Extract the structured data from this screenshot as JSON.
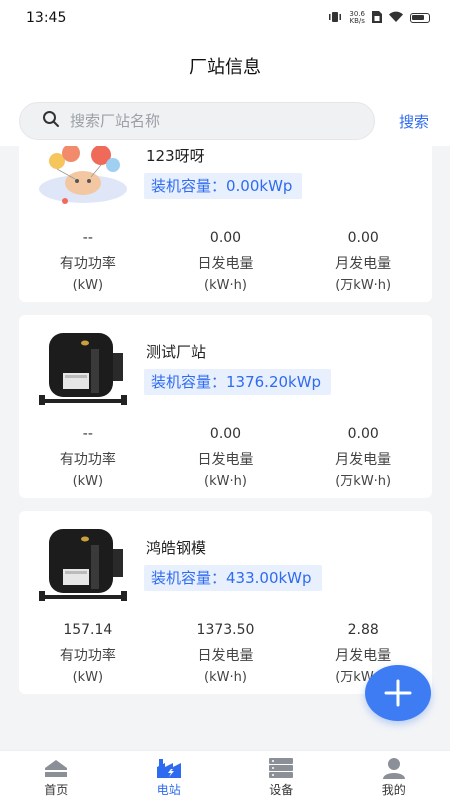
{
  "status_bar": {
    "time": "13:45",
    "net_speed_value": "30.6",
    "net_speed_unit": "KB/s"
  },
  "header": {
    "title": "厂站信息"
  },
  "search": {
    "placeholder": "搜索厂站名称",
    "button_label": "搜索"
  },
  "plants": [
    {
      "name": "123呀呀",
      "capacity": "装机容量：0.00kWp",
      "image": "balloon-illustration",
      "stats": [
        {
          "value": "--",
          "label": "有功功率",
          "unit": "(kW)"
        },
        {
          "value": "0.00",
          "label": "日发电量",
          "unit": "(kW·h)"
        },
        {
          "value": "0.00",
          "label": "月发电量",
          "unit": "(万kW·h)"
        }
      ]
    },
    {
      "name": "测试厂站",
      "capacity": "装机容量：1376.20kWp",
      "image": "inverter-device",
      "stats": [
        {
          "value": "--",
          "label": "有功功率",
          "unit": "(kW)"
        },
        {
          "value": "0.00",
          "label": "日发电量",
          "unit": "(kW·h)"
        },
        {
          "value": "0.00",
          "label": "月发电量",
          "unit": "(万kW·h)"
        }
      ]
    },
    {
      "name": "鸿皓钢模",
      "capacity": "装机容量：433.00kWp",
      "image": "inverter-device",
      "stats": [
        {
          "value": "157.14",
          "label": "有功功率",
          "unit": "(kW)"
        },
        {
          "value": "1373.50",
          "label": "日发电量",
          "unit": "(kW·h)"
        },
        {
          "value": "2.88",
          "label": "月发电量",
          "unit": "(万kW·h)"
        }
      ]
    }
  ],
  "fab": {
    "icon": "plus-icon"
  },
  "tabs": [
    {
      "label": "首页",
      "icon": "home-icon",
      "active": false
    },
    {
      "label": "电站",
      "icon": "factory-icon",
      "active": true
    },
    {
      "label": "设备",
      "icon": "server-icon",
      "active": false
    },
    {
      "label": "我的",
      "icon": "user-icon",
      "active": false
    }
  ],
  "colors": {
    "accent": "#2f6bf0",
    "fab": "#3d7cf2",
    "capacity_bg": "#e8f0fd",
    "page_bg": "#f3f4f6"
  }
}
